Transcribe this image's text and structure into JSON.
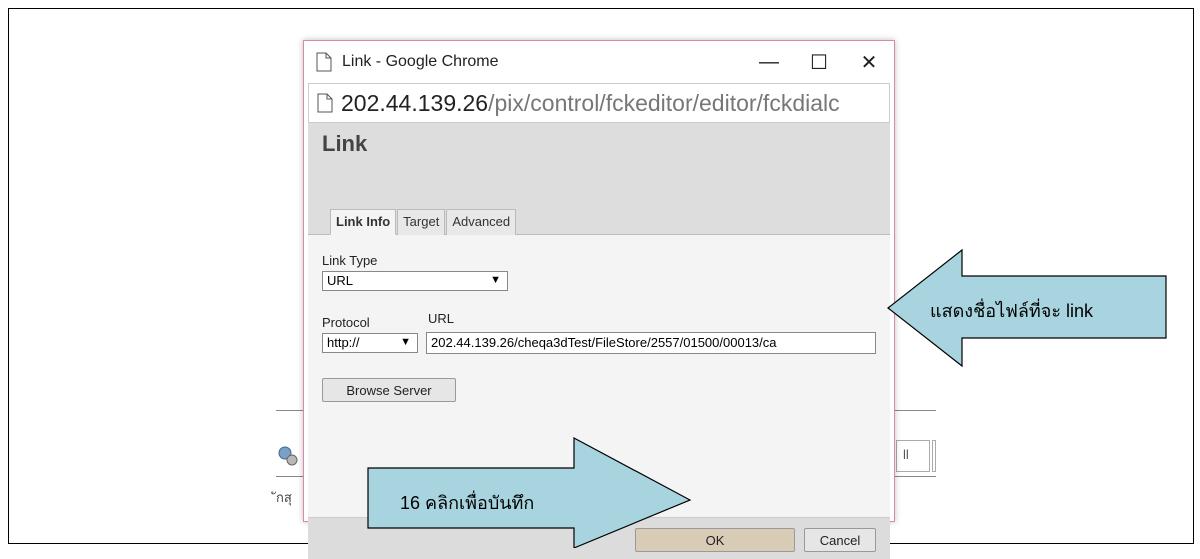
{
  "window": {
    "title": "Link - Google Chrome",
    "minimize": "—",
    "maximize": "☐",
    "close": "✕"
  },
  "address": {
    "host": "202.44.139.26",
    "path": "/pix/control/fckeditor/editor/fckdialc"
  },
  "dialog": {
    "title": "Link",
    "tabs": [
      "Link Info",
      "Target",
      "Advanced"
    ],
    "link_type_label": "Link Type",
    "link_type_value": "URL",
    "protocol_label": "Protocol",
    "protocol_value": "http://",
    "url_label": "URL",
    "url_value": "202.44.139.26/cheqa3dTest/FileStore/2557/01500/00013/ca",
    "browse_button": "Browse Server",
    "ok_button": "OK",
    "cancel_button": "Cancel"
  },
  "background": {
    "stub_text": "ักสุ"
  },
  "annotations": {
    "left_arrow_text": "แสดงชื่อไฟล์ที่จะ link",
    "right_arrow_text": "16 คลิกเพื่อบันทึก",
    "arrow_fill": "#a8d4e0"
  }
}
